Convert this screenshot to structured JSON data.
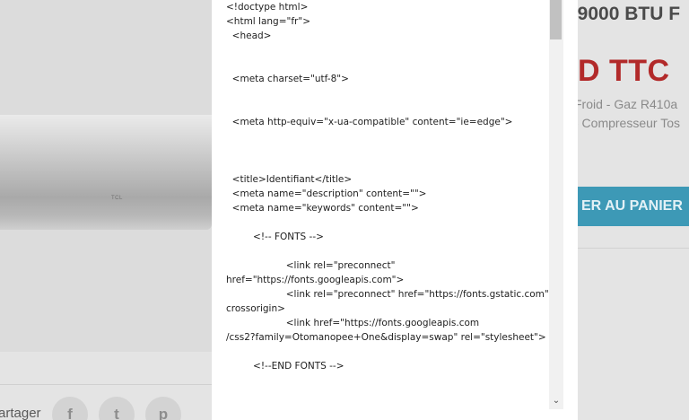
{
  "background_page": {
    "product_title": ". 9000 BTU F",
    "price": "D TTC",
    "description_line1": "Froid - Gaz R410a",
    "description_line2": "- Compresseur Tos",
    "add_to_cart": "ER AU PANIER",
    "brand_logo": "TCL",
    "share_label": "artager",
    "share_icons": [
      "facebook-icon",
      "twitter-icon",
      "pinterest-icon"
    ],
    "share_glyphs": [
      "f",
      "t",
      "p"
    ],
    "colors": {
      "price": "#b22a2a",
      "cart_button": "#3d99b6"
    }
  },
  "modal": {
    "source_lines": [
      "<!doctype html>",
      "<html lang=\"fr\">",
      "  <head>",
      "",
      "",
      "  <meta charset=\"utf-8\">",
      "",
      "",
      "  <meta http-equiv=\"x-ua-compatible\" content=\"ie=edge\">",
      "",
      "",
      "",
      "  <title>Identifiant</title>",
      "  <meta name=\"description\" content=\"\">",
      "  <meta name=\"keywords\" content=\"\">",
      "",
      "         <!-- FONTS -->",
      "",
      "                    <link rel=\"preconnect\"",
      "href=\"https://fonts.googleapis.com\">",
      "                    <link rel=\"preconnect\" href=\"https://fonts.gstatic.com\"",
      "crossorigin>",
      "                    <link href=\"https://fonts.googleapis.com",
      "/css2?family=Otomanopee+One&display=swap\" rel=\"stylesheet\">",
      "",
      "         <!--END FONTS -->"
    ],
    "scroll_down_icon": "chevron-down-icon"
  }
}
